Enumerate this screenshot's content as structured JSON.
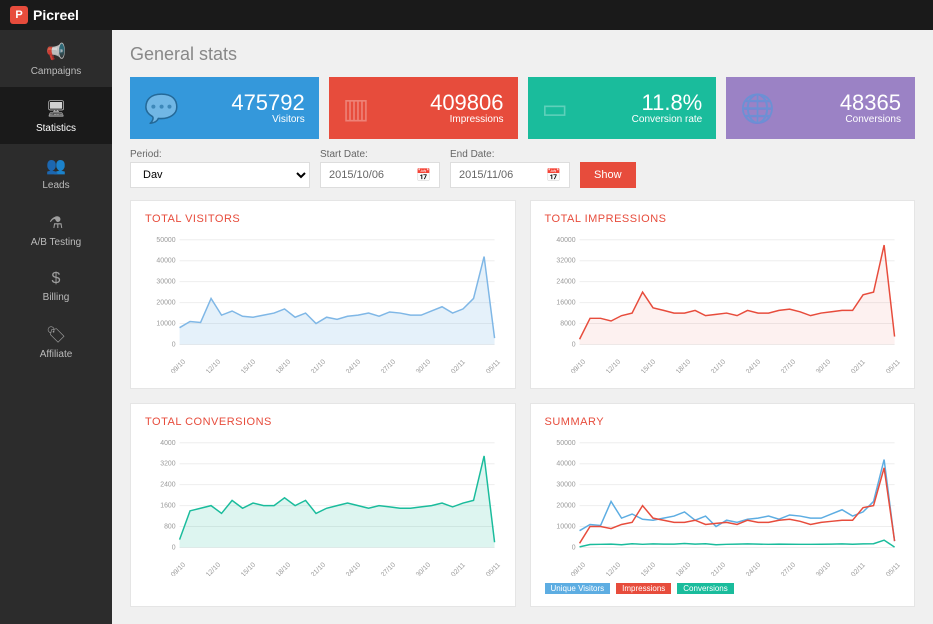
{
  "brand": "Picreel",
  "sidebar": {
    "items": [
      {
        "label": "Campaigns"
      },
      {
        "label": "Statistics"
      },
      {
        "label": "Leads"
      },
      {
        "label": "A/B Testing"
      },
      {
        "label": "Billing"
      },
      {
        "label": "Affiliate"
      }
    ]
  },
  "page_title": "General stats",
  "cards": {
    "visitors": {
      "value": "475792",
      "label": "Visitors"
    },
    "impressions": {
      "value": "409806",
      "label": "Impressions"
    },
    "conv_rate": {
      "value": "11.8%",
      "label": "Conversion rate"
    },
    "conversions": {
      "value": "48365",
      "label": "Conversions"
    }
  },
  "filters": {
    "period_label": "Period:",
    "period_value": "Dav",
    "start_label": "Start Date:",
    "start_value": "2015/10/06",
    "end_label": "End Date:",
    "end_value": "2015/11/06",
    "show": "Show"
  },
  "chart_titles": {
    "visitors": "TOTAL VISITORS",
    "impressions": "TOTAL IMPRESSIONS",
    "conversions": "TOTAL CONVERSIONS",
    "summary": "SUMMARY"
  },
  "legend": {
    "uv": "Unique Visitors",
    "imp": "Impressions",
    "conv": "Conversions"
  },
  "chart_data": [
    {
      "type": "line",
      "title": "TOTAL VISITORS",
      "xlabel": "",
      "ylabel": "",
      "ylim": [
        0,
        50000
      ],
      "categories": [
        "09/10",
        "12/10",
        "15/10",
        "18/10",
        "21/10",
        "24/10",
        "27/10",
        "30/10",
        "02/11",
        "05/11"
      ],
      "series": [
        {
          "name": "Visitors",
          "color": "#7fb7e6",
          "fill": "rgba(127,183,230,0.2)",
          "values": [
            8000,
            11000,
            10500,
            22000,
            14000,
            16000,
            13500,
            13000,
            14000,
            15000,
            17000,
            13000,
            15000,
            10000,
            13000,
            12000,
            13500,
            14000,
            15000,
            13500,
            15500,
            15000,
            14000,
            14000,
            16000,
            18000,
            15000,
            17000,
            22000,
            42000,
            3000
          ]
        }
      ]
    },
    {
      "type": "line",
      "title": "TOTAL IMPRESSIONS",
      "xlabel": "",
      "ylabel": "",
      "ylim": [
        0,
        40000
      ],
      "categories": [
        "09/10",
        "12/10",
        "15/10",
        "18/10",
        "21/10",
        "24/10",
        "27/10",
        "30/10",
        "02/11",
        "05/11"
      ],
      "series": [
        {
          "name": "Impressions",
          "color": "#e74c3c",
          "fill": "rgba(231,76,60,0.08)",
          "values": [
            2000,
            10000,
            10000,
            9000,
            11000,
            12000,
            20000,
            14000,
            13000,
            12000,
            12000,
            13000,
            11000,
            11500,
            12000,
            11000,
            13000,
            12000,
            12000,
            13000,
            13500,
            12500,
            11000,
            12000,
            12500,
            13000,
            13000,
            19000,
            20000,
            38000,
            3000
          ]
        }
      ]
    },
    {
      "type": "line",
      "title": "TOTAL CONVERSIONS",
      "xlabel": "",
      "ylabel": "",
      "ylim": [
        0,
        4000
      ],
      "categories": [
        "09/10",
        "12/10",
        "15/10",
        "18/10",
        "21/10",
        "24/10",
        "27/10",
        "30/10",
        "02/11",
        "05/11"
      ],
      "series": [
        {
          "name": "Conversions",
          "color": "#1abc9c",
          "fill": "rgba(26,188,156,0.15)",
          "values": [
            300,
            1400,
            1500,
            1600,
            1300,
            1800,
            1500,
            1700,
            1600,
            1600,
            1900,
            1600,
            1800,
            1300,
            1500,
            1600,
            1700,
            1600,
            1500,
            1600,
            1550,
            1500,
            1500,
            1550,
            1600,
            1700,
            1550,
            1700,
            1800,
            3500,
            200
          ]
        }
      ]
    },
    {
      "type": "line",
      "title": "SUMMARY",
      "xlabel": "",
      "ylabel": "",
      "ylim": [
        0,
        50000
      ],
      "categories": [
        "09/10",
        "12/10",
        "15/10",
        "18/10",
        "21/10",
        "24/10",
        "27/10",
        "30/10",
        "02/11",
        "05/11"
      ],
      "series": [
        {
          "name": "Unique Visitors",
          "color": "#5dade2",
          "fill": "none",
          "values": [
            8000,
            11000,
            10500,
            22000,
            14000,
            16000,
            13500,
            13000,
            14000,
            15000,
            17000,
            13000,
            15000,
            10000,
            13000,
            12000,
            13500,
            14000,
            15000,
            13500,
            15500,
            15000,
            14000,
            14000,
            16000,
            18000,
            15000,
            17000,
            22000,
            42000,
            3000
          ]
        },
        {
          "name": "Impressions",
          "color": "#e74c3c",
          "fill": "none",
          "values": [
            2000,
            10000,
            10000,
            9000,
            11000,
            12000,
            20000,
            14000,
            13000,
            12000,
            12000,
            13000,
            11000,
            11500,
            12000,
            11000,
            13000,
            12000,
            12000,
            13000,
            13500,
            12500,
            11000,
            12000,
            12500,
            13000,
            13000,
            19000,
            20000,
            38000,
            3000
          ]
        },
        {
          "name": "Conversions",
          "color": "#1abc9c",
          "fill": "none",
          "values": [
            300,
            1400,
            1500,
            1600,
            1300,
            1800,
            1500,
            1700,
            1600,
            1600,
            1900,
            1600,
            1800,
            1300,
            1500,
            1600,
            1700,
            1600,
            1500,
            1600,
            1550,
            1500,
            1500,
            1550,
            1600,
            1700,
            1550,
            1700,
            1800,
            3500,
            200
          ]
        }
      ]
    }
  ]
}
